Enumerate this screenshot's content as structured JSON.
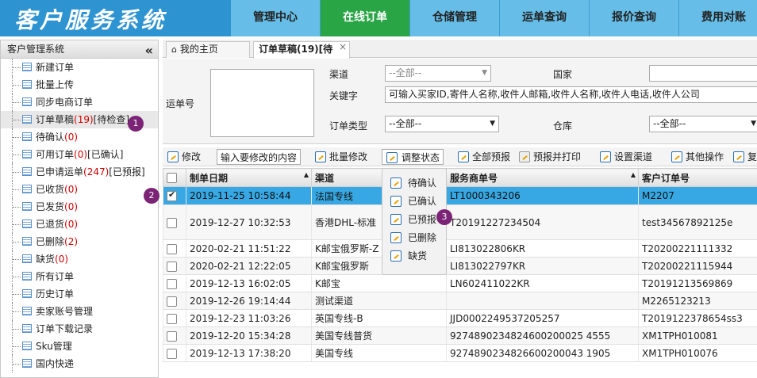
{
  "header": {
    "brand": "客户服务系统",
    "nav": [
      "管理中心",
      "在线订单",
      "仓储管理",
      "运单查询",
      "报价查询",
      "费用对账"
    ]
  },
  "sidebar": {
    "title": "客户管理系统",
    "collapse": "«",
    "items": [
      {
        "label": "新建订单",
        "count": "",
        "suffix": ""
      },
      {
        "label": "批量上传",
        "count": "",
        "suffix": ""
      },
      {
        "label": "同步电商订单",
        "count": "",
        "suffix": ""
      },
      {
        "label": "订单草稿",
        "count": "(19)",
        "suffix": "[待检查]"
      },
      {
        "label": "待确认",
        "count": "(0)",
        "suffix": ""
      },
      {
        "label": "可用订单",
        "count": "(0)",
        "suffix": "[已确认]"
      },
      {
        "label": "已申请运单",
        "count": "(247)",
        "suffix": "[已预报]"
      },
      {
        "label": "已收货",
        "count": "(0)",
        "suffix": ""
      },
      {
        "label": "已发货",
        "count": "(0)",
        "suffix": ""
      },
      {
        "label": "已退货",
        "count": "(0)",
        "suffix": ""
      },
      {
        "label": "已删除",
        "count": "(2)",
        "suffix": ""
      },
      {
        "label": "缺货",
        "count": "(0)",
        "suffix": ""
      },
      {
        "label": "所有订单",
        "count": "",
        "suffix": ""
      },
      {
        "label": "历史订单",
        "count": "",
        "suffix": ""
      },
      {
        "label": "卖家账号管理",
        "count": "",
        "suffix": ""
      },
      {
        "label": "订单下载记录",
        "count": "",
        "suffix": ""
      },
      {
        "label": "Sku管理",
        "count": "",
        "suffix": ""
      },
      {
        "label": "国内快递",
        "count": "",
        "suffix": ""
      }
    ]
  },
  "tabs": {
    "home": "我的主页",
    "draft": "订单草稿(19)[待",
    "close": "×"
  },
  "form": {
    "waybill_label": "运单号",
    "channel_label": "渠道",
    "channel_value": "--全部--",
    "country_label": "国家",
    "keyword_label": "关键字",
    "keyword_placeholder": "可输入买家ID,寄件人名称,收件人邮箱,收件人名称,收件人电话,收件人公司",
    "type_label": "订单类型",
    "type_value": "--全部--",
    "warehouse_label": "仓库",
    "warehouse_value": "--全部--"
  },
  "toolbar": {
    "edit": "修改",
    "edit_input": "输入要修改的内容",
    "batch_edit": "批量修改",
    "adjust_status": "调整状态",
    "all_forecast": "全部预报",
    "forecast_print": "预报并打印",
    "set_channel": "设置渠道",
    "other_ops": "其他操作",
    "copy": "复"
  },
  "status_menu": [
    "待确认",
    "已确认",
    "已预报",
    "已删除",
    "缺货"
  ],
  "badges": [
    "1",
    "2",
    "3"
  ],
  "table": {
    "headers": [
      "制单日期",
      "渠道",
      "服务商单号",
      "客户订单号"
    ],
    "rows": [
      {
        "date": "2019-11-25 10:58:44",
        "channel": "法国专线",
        "tracking": "LT1000343206",
        "order": "M2207"
      },
      {
        "date": "2019-12-27 10:32:53",
        "channel": "香港DHL-标准",
        "tracking": "T20191227234504",
        "order": "test34567892125e"
      },
      {
        "date": "2020-02-21 11:51:22",
        "channel": "K邮宝俄罗斯-Z",
        "tracking": "LI813022806KR",
        "order": "T20200221111332"
      },
      {
        "date": "2020-02-21 12:22:05",
        "channel": "K邮宝俄罗斯",
        "tracking": "LI813022797KR",
        "order": "T20200221115944"
      },
      {
        "date": "2019-12-13 16:02:05",
        "channel": "K邮宝",
        "tracking": "LN602411022KR",
        "order": "T20191213569869"
      },
      {
        "date": "2019-12-26 19:14:44",
        "channel": "测试渠道",
        "tracking": "",
        "order": "M2265123213"
      },
      {
        "date": "2019-12-23 11:03:26",
        "channel": "英国专线-B",
        "tracking": "JJD0002249537205257",
        "order": "T2019122378654ss3"
      },
      {
        "date": "2019-12-20 15:34:28",
        "channel": "美国专线普货",
        "tracking": "9274890234824600200025 4555",
        "order": "XM1TPH010081"
      },
      {
        "date": "2019-12-13 17:38:20",
        "channel": "美国专线",
        "tracking": "9274890234826600200043 1905",
        "order": "XM1TPH010076"
      }
    ]
  }
}
